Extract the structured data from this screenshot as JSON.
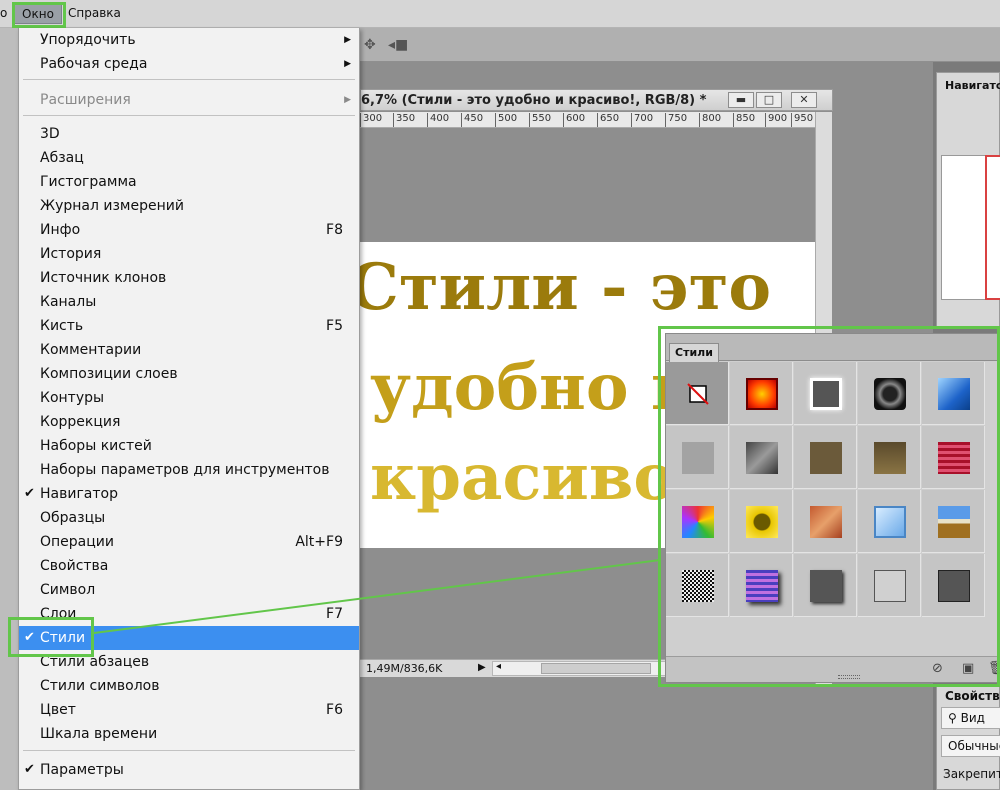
{
  "menubar": {
    "items": [
      {
        "label": "о"
      },
      {
        "label": "Окно"
      },
      {
        "label": "Справка"
      }
    ]
  },
  "window_menu": {
    "items": [
      {
        "label": "Упорядочить",
        "submenu": true
      },
      {
        "label": "Рабочая среда",
        "submenu": true
      },
      {
        "label": "Расширения",
        "submenu": true,
        "disabled": true
      },
      {
        "label": "3D"
      },
      {
        "label": "Абзац"
      },
      {
        "label": "Гистограмма"
      },
      {
        "label": "Журнал измерений"
      },
      {
        "label": "Инфо",
        "shortcut": "F8"
      },
      {
        "label": "История"
      },
      {
        "label": "Источник клонов"
      },
      {
        "label": "Каналы"
      },
      {
        "label": "Кисть",
        "shortcut": "F5"
      },
      {
        "label": "Комментарии"
      },
      {
        "label": "Композиции слоев"
      },
      {
        "label": "Контуры"
      },
      {
        "label": "Коррекция"
      },
      {
        "label": "Наборы кистей"
      },
      {
        "label": "Наборы параметров для инструментов"
      },
      {
        "label": "Навигатор",
        "checked": true
      },
      {
        "label": "Образцы"
      },
      {
        "label": "Операции",
        "shortcut": "Alt+F9"
      },
      {
        "label": "Свойства"
      },
      {
        "label": "Символ"
      },
      {
        "label": "Слои",
        "shortcut": "F7"
      },
      {
        "label": "Стили",
        "checked": true,
        "selected": true
      },
      {
        "label": "Стили абзацев"
      },
      {
        "label": "Стили символов"
      },
      {
        "label": "Цвет",
        "shortcut": "F6"
      },
      {
        "label": "Шкала времени"
      },
      {
        "label": "Параметры",
        "checked": true
      }
    ]
  },
  "document": {
    "title": "6,7% (Стили - это удобно и красиво!, RGB/8) *",
    "buttons": {
      "minimize": "▬",
      "maximize": "□",
      "close": "✕"
    },
    "ruler_ticks": [
      "300",
      "350",
      "400",
      "450",
      "500",
      "550",
      "600",
      "650",
      "700",
      "750",
      "800",
      "850",
      "900",
      "950"
    ],
    "canvas_lines": [
      "Стили - это",
      "удобно и",
      "красиво!"
    ],
    "status": "1,49M/836,6K",
    "status_arrow": "▶",
    "scroll_left": "◂"
  },
  "navigator_panel": {
    "title": "Навигатор"
  },
  "properties_panel": {
    "title": "Свойства",
    "view_button": "Вид",
    "mode_button": "Обычные",
    "lock_label": "Закрепить"
  },
  "styles_panel": {
    "tab": "Стили",
    "footer_icons": [
      "no-style-icon",
      "new-style-icon",
      "trash-icon"
    ]
  },
  "colors": {
    "accent": "#62c64a",
    "selection": "#3c8ff0",
    "canvas_text_dark": "#9b7b0c",
    "canvas_text_light": "#d8b830"
  }
}
